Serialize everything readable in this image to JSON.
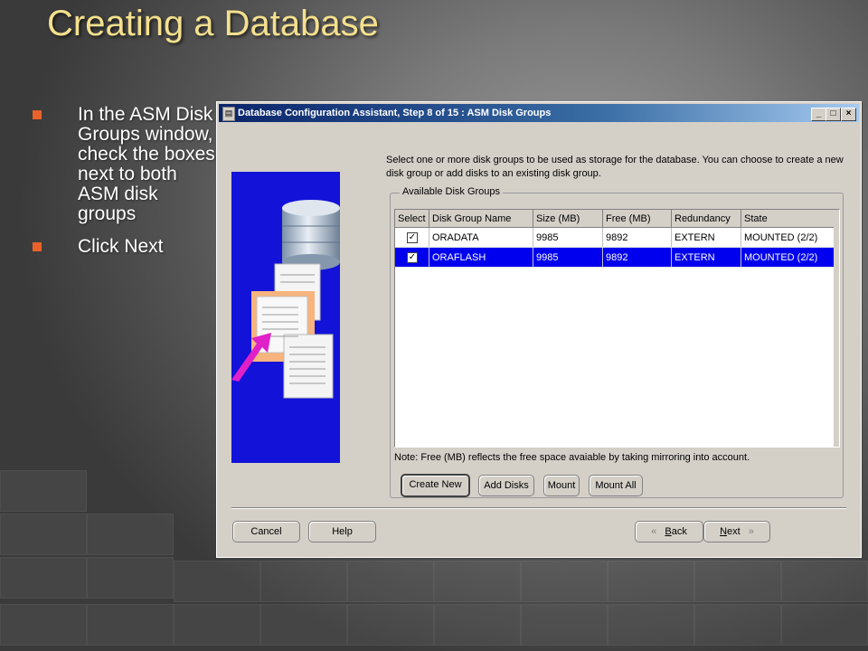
{
  "slide": {
    "title": "Creating a Database",
    "bullets": [
      "In the ASM Disk Groups window, check the boxes next to both ASM disk groups",
      "Click Next"
    ]
  },
  "window": {
    "title": "Database Configuration Assistant, Step 8 of 15 : ASM Disk Groups",
    "minimize": "_",
    "maximize": "□",
    "close": "×",
    "instructions": "Select one or more disk groups to be used as storage for the database. You can choose to create a new disk group or add disks to an existing disk group.",
    "group_title": "Available Disk Groups",
    "table": {
      "headers": [
        "Select",
        "Disk Group Name",
        "Size (MB)",
        "Free (MB)",
        "Redundancy",
        "State"
      ],
      "rows": [
        {
          "selected": "✓",
          "name": "ORADATA",
          "size": "9985",
          "free": "9892",
          "redundancy": "EXTERN",
          "state": "MOUNTED (2/2)"
        },
        {
          "selected": "✓",
          "name": "ORAFLASH",
          "size": "9985",
          "free": "9892",
          "redundancy": "EXTERN",
          "state": "MOUNTED (2/2)"
        }
      ]
    },
    "note": "Note: Free (MB) reflects the free space avaiable by taking mirroring into account.",
    "group_buttons": {
      "create_new": "Create New",
      "add_disks": "Add Disks",
      "mount": "Mount",
      "mount_all": "Mount All"
    },
    "footer": {
      "cancel": "Cancel",
      "help": "Help",
      "back_arrow": "«",
      "back_mnemonic": "B",
      "back_rest": "ack",
      "next_mnemonic": "N",
      "next_rest": "ext",
      "next_arrow": "»"
    }
  },
  "colors": {
    "title_yellow": "#f4e08e",
    "bullet_orange": "#e8622a",
    "selection_blue": "#0000ee",
    "side_image_blue": "#1212d8"
  }
}
